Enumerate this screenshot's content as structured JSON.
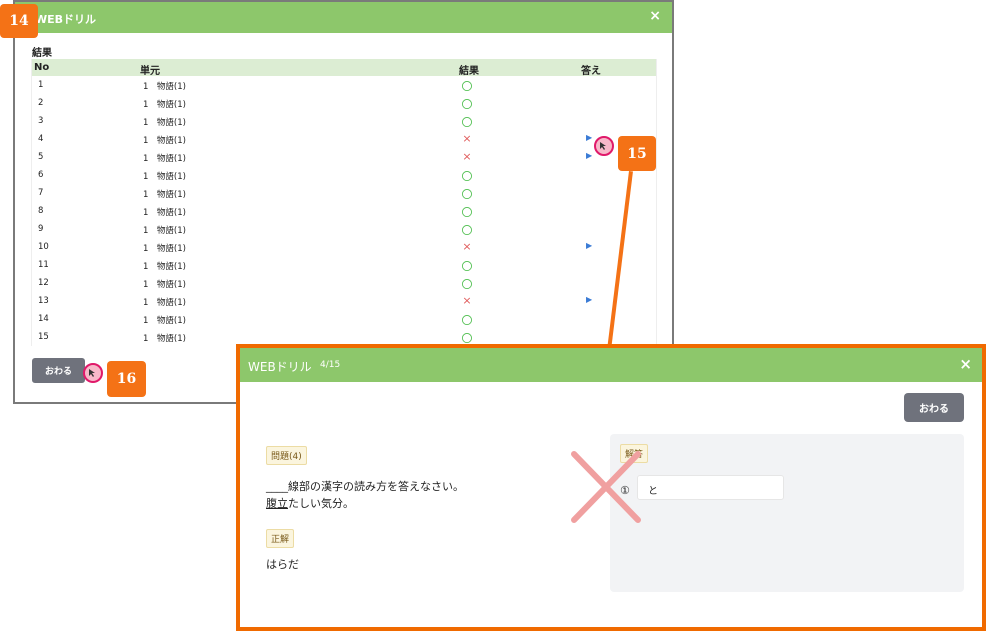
{
  "drill_list_window": {
    "title": "WEBドリル",
    "close": "×",
    "section_label": "結果",
    "headers": {
      "no": "No",
      "unit": "単元",
      "result": "結果",
      "answer": "答え"
    },
    "rows": [
      {
        "no": "1",
        "unit": "1　物語(1)",
        "result": "〇",
        "status": "correct",
        "answer": ""
      },
      {
        "no": "2",
        "unit": "1　物語(1)",
        "result": "〇",
        "status": "correct",
        "answer": ""
      },
      {
        "no": "3",
        "unit": "1　物語(1)",
        "result": "〇",
        "status": "correct",
        "answer": ""
      },
      {
        "no": "4",
        "unit": "1　物語(1)",
        "result": "×",
        "status": "wrong",
        "answer": "▶"
      },
      {
        "no": "5",
        "unit": "1　物語(1)",
        "result": "×",
        "status": "wrong",
        "answer": "▶"
      },
      {
        "no": "6",
        "unit": "1　物語(1)",
        "result": "〇",
        "status": "correct",
        "answer": ""
      },
      {
        "no": "7",
        "unit": "1　物語(1)",
        "result": "〇",
        "status": "correct",
        "answer": ""
      },
      {
        "no": "8",
        "unit": "1　物語(1)",
        "result": "〇",
        "status": "correct",
        "answer": ""
      },
      {
        "no": "9",
        "unit": "1　物語(1)",
        "result": "〇",
        "status": "correct",
        "answer": ""
      },
      {
        "no": "10",
        "unit": "1　物語(1)",
        "result": "×",
        "status": "wrong",
        "answer": "▶"
      },
      {
        "no": "11",
        "unit": "1　物語(1)",
        "result": "〇",
        "status": "correct",
        "answer": ""
      },
      {
        "no": "12",
        "unit": "1　物語(1)",
        "result": "〇",
        "status": "correct",
        "answer": ""
      },
      {
        "no": "13",
        "unit": "1　物語(1)",
        "result": "×",
        "status": "wrong",
        "answer": "▶"
      },
      {
        "no": "14",
        "unit": "1　物語(1)",
        "result": "〇",
        "status": "correct",
        "answer": ""
      },
      {
        "no": "15",
        "unit": "1　物語(1)",
        "result": "〇",
        "status": "correct",
        "answer": ""
      }
    ],
    "end_button": "おわる"
  },
  "callouts": {
    "c14": "14",
    "c15": "15",
    "c16": "16"
  },
  "question_window": {
    "title": "WEBドリル",
    "counter": "4/15",
    "close": "×",
    "end_button": "おわる",
    "question_tag": "問題(4)",
    "question_line1": "____線部の漢字の読み方を答えなさい。",
    "question_underlined": "腹立",
    "question_rest": "たしい気分。",
    "correct_tag": "正解",
    "correct_answer": "はらだ",
    "answer_tag": "解答",
    "answer_number": "①",
    "answer_value": "と"
  },
  "colors": {
    "titlebar": "#8dc76b",
    "callout": "#f47216",
    "correct": "#4fbf4f",
    "wrong": "#e05a5a",
    "link": "#3a7bd5"
  }
}
